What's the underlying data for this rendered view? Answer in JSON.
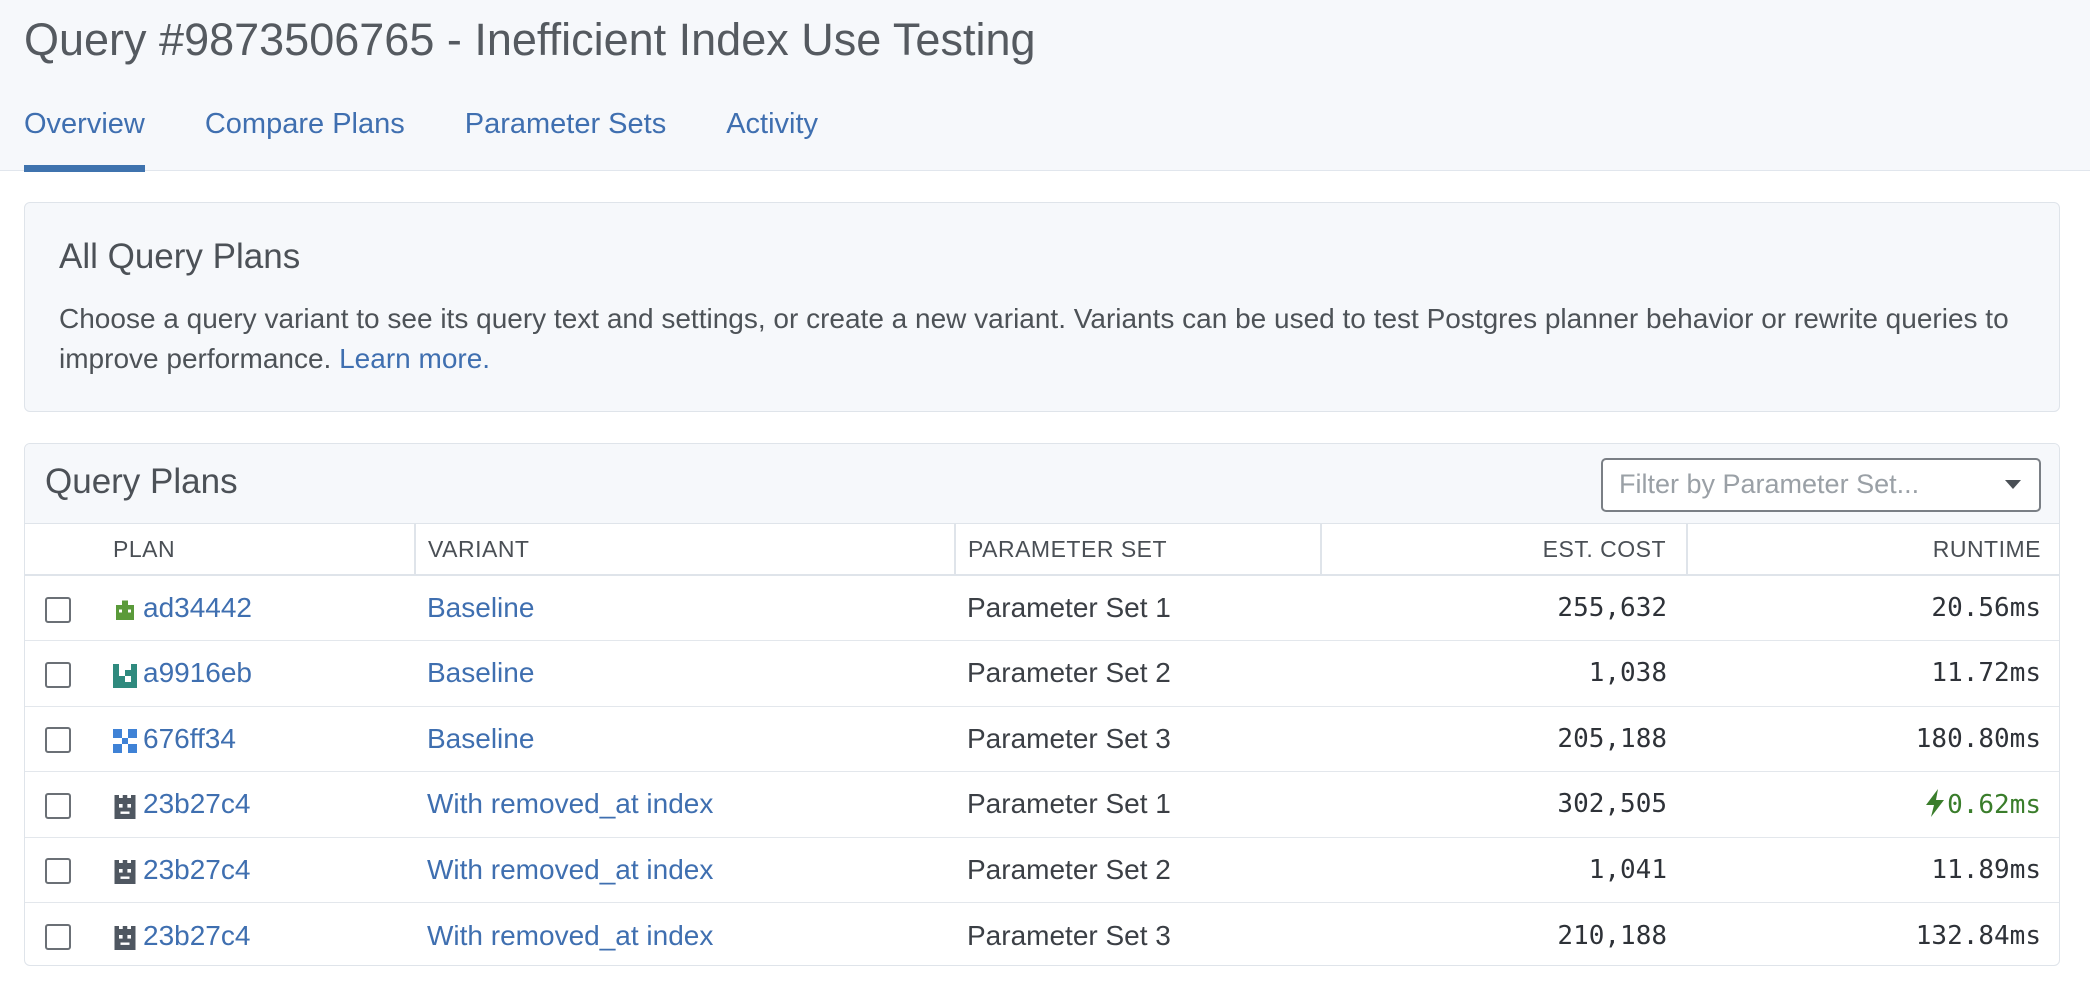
{
  "header": {
    "title": "Query #9873506765 - Inefficient Index Use Testing",
    "tabs": [
      {
        "label": "Overview",
        "active": true
      },
      {
        "label": "Compare Plans"
      },
      {
        "label": "Parameter Sets"
      },
      {
        "label": "Activity"
      }
    ]
  },
  "info": {
    "title": "All Query Plans",
    "text": "Choose a query variant to see its query text and settings, or create a new variant. Variants can be used to test Postgres planner behavior or rewrite queries to improve performance. ",
    "link": "Learn more."
  },
  "plans": {
    "title": "Query Plans",
    "filter_placeholder": "Filter by Parameter Set...",
    "columns": [
      "PLAN",
      "VARIANT",
      "PARAMETER SET",
      "EST. COST",
      "RUNTIME"
    ],
    "rows": [
      {
        "plan": "ad34442",
        "icon": "green-robot-icon",
        "variant": "Baseline",
        "param_set": "Parameter Set 1",
        "est_cost": "255,632",
        "runtime": "20.56ms"
      },
      {
        "plan": "a9916eb",
        "icon": "teal-pattern-icon",
        "variant": "Baseline",
        "param_set": "Parameter Set 2",
        "est_cost": "1,038",
        "runtime": "11.72ms"
      },
      {
        "plan": "676ff34",
        "icon": "blue-pattern-icon",
        "variant": "Baseline",
        "param_set": "Parameter Set 3",
        "est_cost": "205,188",
        "runtime": "180.80ms"
      },
      {
        "plan": "23b27c4",
        "icon": "gray-robot-icon",
        "variant": "With removed_at index",
        "param_set": "Parameter Set 1",
        "est_cost": "302,505",
        "runtime": "0.62ms",
        "fastest": true
      },
      {
        "plan": "23b27c4",
        "icon": "gray-robot-icon",
        "variant": "With removed_at index",
        "param_set": "Parameter Set 2",
        "est_cost": "1,041",
        "runtime": "11.89ms"
      },
      {
        "plan": "23b27c4",
        "icon": "gray-robot-icon",
        "variant": "With removed_at index",
        "param_set": "Parameter Set 3",
        "est_cost": "210,188",
        "runtime": "132.84ms"
      }
    ]
  },
  "colors": {
    "accent": "#3f6fb0",
    "fast": "#3a7d2b",
    "icon_green": "#5a9a3a",
    "icon_teal": "#2f8a7e",
    "icon_blue": "#3f82d6",
    "icon_gray": "#4f5761"
  }
}
